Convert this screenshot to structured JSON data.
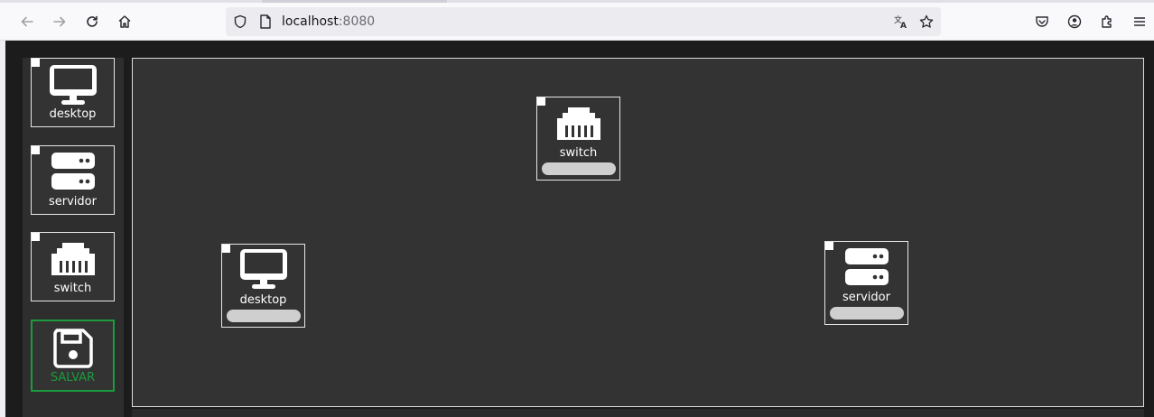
{
  "browser": {
    "url_host": "localhost",
    "url_port": ":8080",
    "icons": [
      "back-icon",
      "forward-icon",
      "reload-icon",
      "home-icon",
      "shield-icon",
      "page-icon",
      "translate-icon",
      "star-icon",
      "pocket-icon",
      "account-icon",
      "extensions-icon",
      "menu-icon"
    ]
  },
  "palette": {
    "items": [
      {
        "label": "desktop",
        "icon": "desktop-icon"
      },
      {
        "label": "servidor",
        "icon": "server-icon"
      },
      {
        "label": "switch",
        "icon": "switch-icon"
      }
    ],
    "save_label": "SALVAR",
    "save_icon": "floppy-disk-icon"
  },
  "canvas": {
    "nodes": [
      {
        "label": "switch",
        "icon": "switch-icon",
        "name_value": ""
      },
      {
        "label": "desktop",
        "icon": "desktop-icon",
        "name_value": ""
      },
      {
        "label": "servidor",
        "icon": "server-icon",
        "name_value": ""
      }
    ]
  },
  "colors": {
    "save_green": "#1c9b3c",
    "canvas_bg": "#333333",
    "app_bg": "#1c1c1c"
  }
}
